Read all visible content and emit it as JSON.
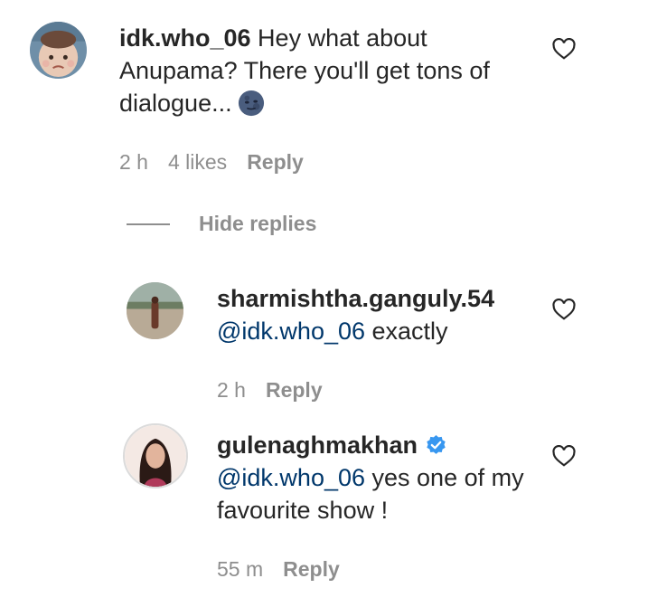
{
  "comments": [
    {
      "username": "idk.who_06",
      "text": " Hey what about Anupama? There you'll get tons of dialogue...",
      "emoji": "new-moon-face-emoji",
      "time": "2 h",
      "likes": "4 likes",
      "reply_label": "Reply"
    }
  ],
  "hide_replies_label": "Hide replies",
  "replies": [
    {
      "username": "sharmishtha.ganguly.54",
      "mention": "@idk.who_06",
      "text": " exactly",
      "time": "2 h",
      "reply_label": "Reply"
    },
    {
      "username": "gulenaghmakhan",
      "verified": true,
      "mention": "@idk.who_06",
      "text": " yes one of my favourite show !",
      "time": "55 m",
      "reply_label": "Reply"
    }
  ],
  "colors": {
    "text": "#262626",
    "meta": "#8e8e8e",
    "mention": "#00376b",
    "verified": "#3897f0"
  }
}
